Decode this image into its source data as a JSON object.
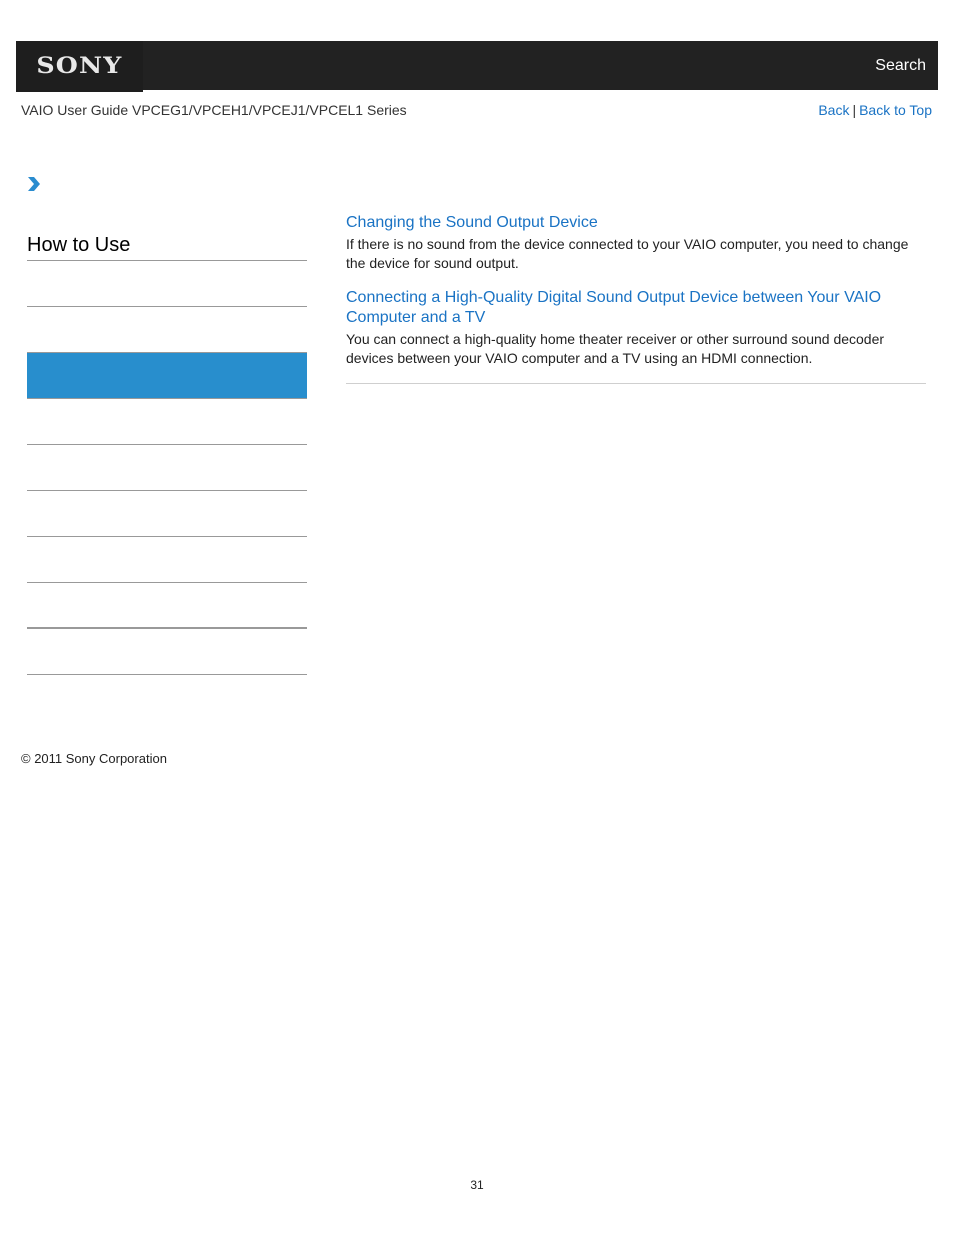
{
  "header": {
    "logo_text": "SONY",
    "search_label": "Search"
  },
  "subheader": {
    "guide_title": "VAIO User Guide VPCEG1/VPCEH1/VPCEJ1/VPCEL1 Series",
    "back_label": "Back",
    "separator": "|",
    "back_to_top_label": "Back to Top"
  },
  "breadcrumb": {
    "icon": "chevron-right-icon"
  },
  "sidebar": {
    "title": "How to Use",
    "items": [
      {
        "label": "",
        "active": false
      },
      {
        "label": "",
        "active": false
      },
      {
        "label": "",
        "active": true
      },
      {
        "label": "",
        "active": false
      },
      {
        "label": "",
        "active": false
      },
      {
        "label": "",
        "active": false
      },
      {
        "label": "",
        "active": false
      },
      {
        "label": "",
        "active": false
      },
      {
        "label": "",
        "active": false
      }
    ]
  },
  "main": {
    "topics": [
      {
        "title": "Changing the Sound Output Device",
        "description": "If there is no sound from the device connected to your VAIO computer, you need to change the device for sound output."
      },
      {
        "title": "Connecting a High-Quality Digital Sound Output Device between Your VAIO Computer and a TV",
        "description": "You can connect a high-quality home theater receiver or other surround sound decoder devices between your VAIO computer and a TV using an HDMI connection."
      }
    ]
  },
  "footer": {
    "copyright": "© 2011 Sony Corporation",
    "page_number": "31"
  },
  "colors": {
    "header_bg": "#222222",
    "link": "#1a73c4",
    "active_item": "#288ecd"
  }
}
